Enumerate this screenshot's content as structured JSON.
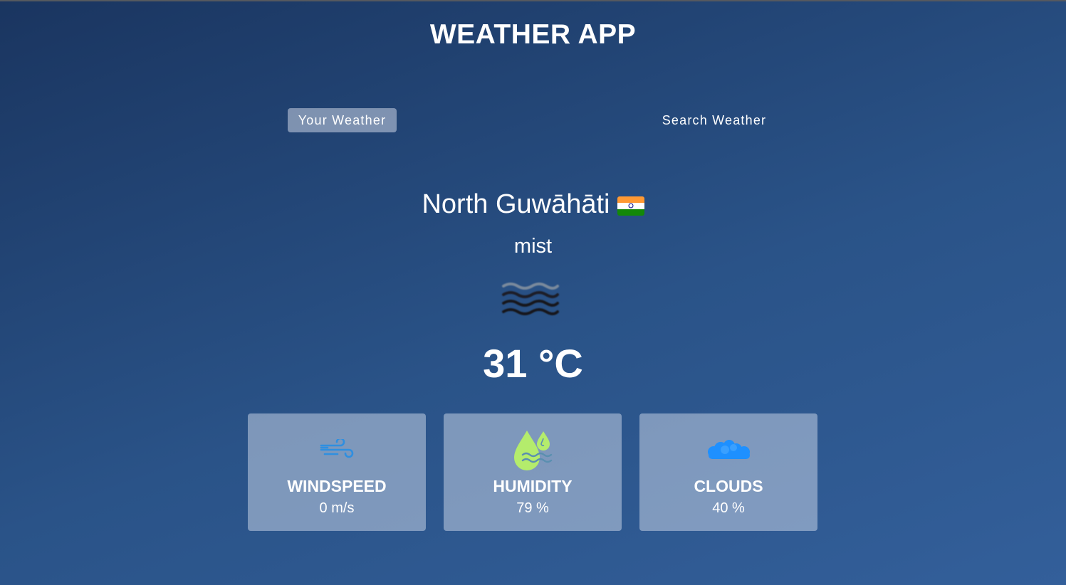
{
  "app": {
    "title": "WEATHER APP"
  },
  "tabs": [
    {
      "label": "Your Weather",
      "active": true
    },
    {
      "label": "Search Weather",
      "active": false
    }
  ],
  "location": {
    "city": "North Guwāhāti",
    "country_flag": "india-flag-icon"
  },
  "weather": {
    "description": "mist",
    "icon": "mist-icon",
    "temperature": "31 °C"
  },
  "cards": [
    {
      "label": "WINDSPEED",
      "value": "0 m/s",
      "icon": "wind-icon"
    },
    {
      "label": "HUMIDITY",
      "value": "79 %",
      "icon": "humidity-icon"
    },
    {
      "label": "CLOUDS",
      "value": "40 %",
      "icon": "clouds-icon"
    }
  ],
  "colors": {
    "background_top": "#1a3560",
    "background_bottom": "#335f9a",
    "card_background": "#8a9dbd",
    "wind_icon": "#2f8fe0",
    "humidity_icon": "#b4ec6c",
    "clouds_icon": "#1e90ff"
  }
}
